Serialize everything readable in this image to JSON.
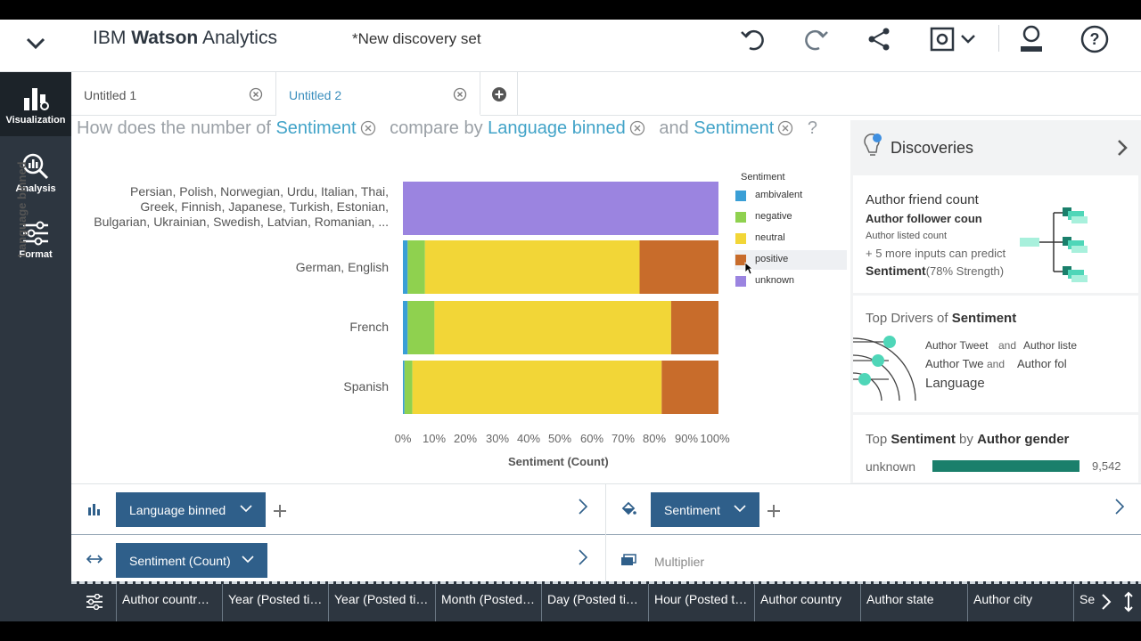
{
  "header": {
    "app_title_prefix": "IBM",
    "app_title_bold": "Watson",
    "app_title_suffix": "Analytics",
    "doc_title": "*New discovery set"
  },
  "nav": {
    "items": [
      {
        "label": "Visualization"
      },
      {
        "label": "Analysis"
      },
      {
        "label": "Format"
      }
    ]
  },
  "tabs": [
    {
      "label": "Untitled 1",
      "active": false
    },
    {
      "label": "Untitled 2",
      "active": true
    }
  ],
  "question": {
    "p1": "How does the number of",
    "t1": "Sentiment",
    "p2": "compare by",
    "t2": "Language binned",
    "p3": "and",
    "t3": "Sentiment",
    "p4": "?"
  },
  "chart_data": {
    "type": "bar",
    "orientation": "horizontal",
    "stacked": "100%",
    "ylabel": "Language binned",
    "xlabel": "Sentiment (Count)",
    "x_ticks": [
      "0%",
      "10%",
      "20%",
      "30%",
      "40%",
      "50%",
      "60%",
      "70%",
      "80%",
      "90%",
      "100%"
    ],
    "xlim": [
      0,
      100
    ],
    "categories": [
      "Persian, Polish, Norwegian, Urdu, Italian, Thai, Greek, Finnish, Japanese, Turkish, Estonian, Bulgarian, Ukrainian, Swedish, Latvian, Romanian, ...",
      "German, English",
      "French",
      "Spanish"
    ],
    "category_lines": [
      [
        "Persian, Polish, Norwegian, Urdu, Italian, Thai,",
        "Greek, Finnish, Japanese, Turkish, Estonian,",
        "Bulgarian, Ukrainian, Swedish, Latvian, Romanian, ..."
      ],
      [
        "German, English"
      ],
      [
        "French"
      ],
      [
        "Spanish"
      ]
    ],
    "legend_title": "Sentiment",
    "legend_position": "right",
    "series": [
      {
        "name": "ambivalent",
        "color": "#3a9fd6",
        "values": [
          0,
          1.5,
          1.5,
          0.5
        ]
      },
      {
        "name": "negative",
        "color": "#8fd14f",
        "values": [
          0,
          5.5,
          8.5,
          2.5
        ]
      },
      {
        "name": "neutral",
        "color": "#f2d637",
        "values": [
          0,
          68,
          75,
          79
        ]
      },
      {
        "name": "positive",
        "color": "#c86c2b",
        "values": [
          0,
          25,
          15,
          18
        ]
      },
      {
        "name": "unknown",
        "color": "#9b84e0",
        "values": [
          100,
          0,
          0,
          0
        ]
      }
    ]
  },
  "discoveries": {
    "title": "Discoveries",
    "card1": {
      "line1": "Author friend count",
      "line2": "Author follower coun",
      "line3": "Author listed count",
      "line4": "+ 5 more inputs can predict",
      "line5": "Sentiment",
      "strength": "(78% Strength)"
    },
    "card2": {
      "title_prefix": "Top Drivers of",
      "title_target": "Sentiment",
      "t1": "Author Tweet",
      "t1b": "and",
      "t1c": "Author liste",
      "t2": "Author Twe",
      "t2b": "and",
      "t2c": "Author fol",
      "t3": "Language"
    },
    "card3": {
      "title_prefix": "Top",
      "title_a": "Sentiment",
      "title_mid": "by",
      "title_b": "Author gender",
      "label": "unknown",
      "value": "9,542"
    }
  },
  "shelves": {
    "columns_pill": "Language binned",
    "color_pill": "Sentiment",
    "size_pill": "Sentiment (Count)",
    "multiplier": "Multiplier"
  },
  "columns": [
    "Author countr…",
    "Year (Posted ti…",
    "Year (Posted ti…",
    "Month (Posted…",
    "Day (Posted ti…",
    "Hour (Posted t…",
    "Author country",
    "Author state",
    "Author city",
    "Se"
  ]
}
